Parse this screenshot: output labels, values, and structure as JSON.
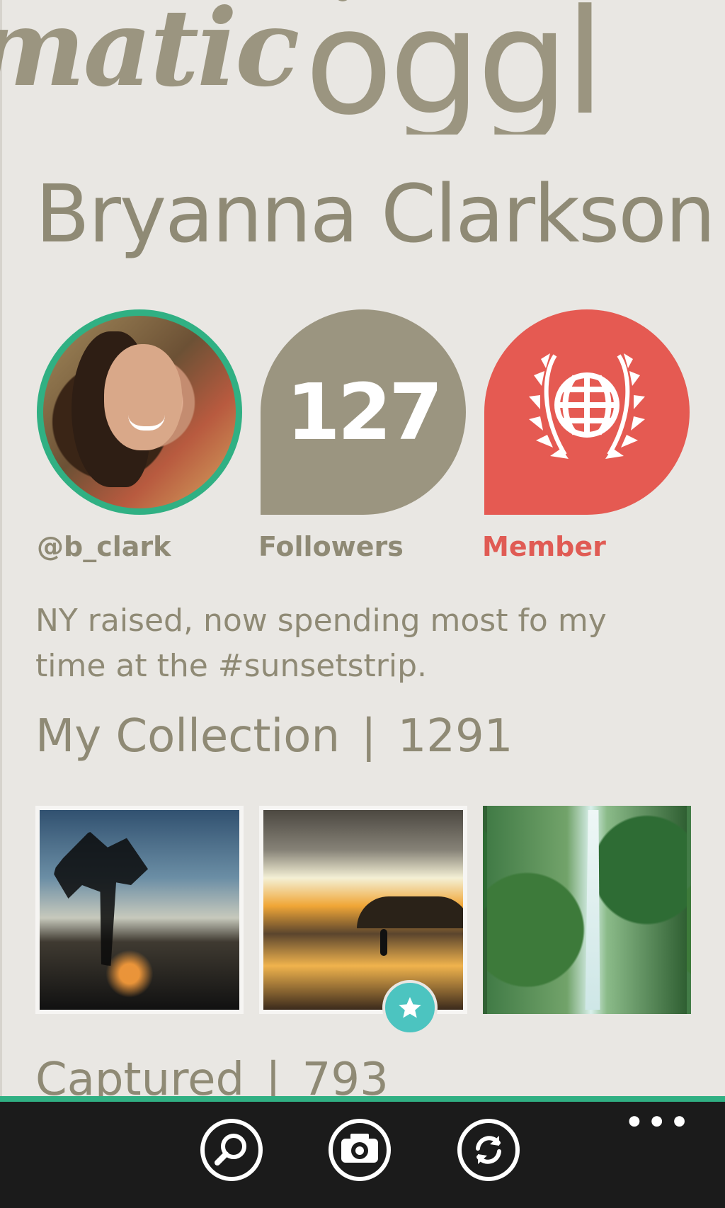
{
  "panorama": {
    "previous_title": "matic",
    "brand_title": "oggl"
  },
  "profile": {
    "name": "Bryanna Clarkson",
    "handle": "@b_clark",
    "followers_count": "127",
    "followers_label": "Followers",
    "member_label": "Member",
    "bio": "NY raised,  now spending most fo my time at the #sunsetstrip."
  },
  "collection": {
    "label": "My Collection",
    "separator": "|",
    "count": "1291"
  },
  "captured": {
    "label": "Captured",
    "separator": "|",
    "count": "793"
  },
  "appbar": {
    "more": "•••",
    "buttons": [
      "search-icon",
      "camera-icon",
      "refresh-icon"
    ]
  },
  "colors": {
    "background": "#e9e7e3",
    "taupe": "#9b9580",
    "member_red": "#e55a52",
    "accent_green": "#30b083",
    "badge_teal": "#4cc4c0",
    "appbar": "#1b1b1b"
  }
}
